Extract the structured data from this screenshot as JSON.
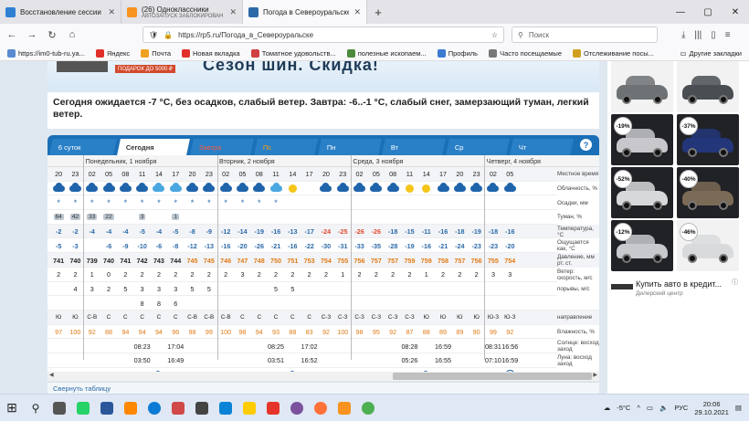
{
  "browser": {
    "tabs": [
      {
        "title": "Восстановление сессии",
        "sub": "",
        "color": "#2f7fd3",
        "active": false
      },
      {
        "title": "(26) Одноклассники",
        "sub": "АВТОЗАПУСК ЗАБЛОКИРОВАН",
        "color": "#f7931e",
        "active": false
      },
      {
        "title": "Погода в Североуральске - РП5",
        "sub": "",
        "color": "#2b6aa8",
        "active": true
      }
    ],
    "tab_close": "✕",
    "new_tab": "+",
    "window_controls": [
      "—",
      "▢",
      "✕"
    ],
    "nav": {
      "back": "←",
      "forward": "→",
      "reload": "↻",
      "home": "⌂"
    },
    "url": "https://rp5.ru/Погода_в_Североуральске",
    "search_placeholder": "Поиск",
    "bookmarks": [
      {
        "label": "https://im0-tub-ru.ya...",
        "color": "#5a8ad0"
      },
      {
        "label": "Яндекс",
        "color": "#e0302a"
      },
      {
        "label": "Почта",
        "color": "#f0a020"
      },
      {
        "label": "Новая вкладка",
        "color": "#e0302a"
      },
      {
        "label": "Томатное удовольств...",
        "color": "#d04040"
      },
      {
        "label": "полезные ископаем...",
        "color": "#4b8b3b"
      },
      {
        "label": "Профиль",
        "color": "#3b7bd0"
      },
      {
        "label": "Часто посещаемые",
        "color": "#777777"
      },
      {
        "label": "Отслеживание посы...",
        "color": "#d0a020"
      }
    ],
    "other_bookmarks": "Другие закладки"
  },
  "page": {
    "banner_text": "Сезон шин. Скидка!",
    "banner_small": "ПОДАРОК ДО 5000 ₽",
    "summary": "Сегодня ожидается -7 °С, без осадков, слабый ветер. Завтра: -6..-1 °С, слабый снег, замерзающий туман, легкий ветер.",
    "weather_tabs": [
      {
        "label": "6 суток",
        "style": "normal"
      },
      {
        "label": "Сегодня",
        "style": "active"
      },
      {
        "label": "Завтра",
        "style": "red"
      },
      {
        "label": "Пс",
        "style": "orange"
      },
      {
        "label": "Пн",
        "style": "normal"
      },
      {
        "label": "Вт",
        "style": "normal"
      },
      {
        "label": "Ср",
        "style": "normal"
      },
      {
        "label": "Чт",
        "style": "normal"
      }
    ],
    "help": "?",
    "days": [
      {
        "label": "Понедельник, 1 ноября",
        "start": 2
      },
      {
        "label": "Вторник, 2 ноября",
        "start": 10
      },
      {
        "label": "Среда, 3 ноября",
        "start": 18
      },
      {
        "label": "Четверг, 4 ноября",
        "start": 26
      }
    ],
    "hours": [
      "20",
      "23",
      "02",
      "05",
      "08",
      "11",
      "14",
      "17",
      "20",
      "23",
      "02",
      "05",
      "08",
      "11",
      "14",
      "17",
      "20",
      "23",
      "02",
      "05",
      "08",
      "11",
      "14",
      "17",
      "20",
      "23",
      "02",
      "05"
    ],
    "cloud_icons": [
      "cloud",
      "cloud",
      "cloud",
      "cloud",
      "cloud",
      "cloud",
      "cloud-light",
      "cloud-light",
      "cloud",
      "cloud",
      "cloud",
      "cloud",
      "cloud",
      "cloud-light",
      "sun",
      "",
      "cloud",
      "cloud",
      "cloud",
      "cloud",
      "cloud",
      "sun",
      "sun",
      "cloud",
      "cloud",
      "cloud",
      "cloud",
      "cloud"
    ],
    "precip": [
      "*",
      "*",
      "*",
      "*",
      "*",
      "*",
      "*",
      "*",
      "*",
      "*",
      "*",
      "*",
      "*",
      "*",
      "",
      "",
      "",
      "",
      "",
      "",
      "",
      "",
      "",
      "",
      "",
      "",
      "",
      ""
    ],
    "fog": [
      "64",
      "42",
      "33",
      "22",
      "",
      "3",
      "",
      "1",
      "",
      "",
      "",
      "",
      "",
      "",
      "",
      "",
      "",
      "",
      "",
      "",
      "",
      "",
      "",
      "",
      "",
      "",
      "",
      ""
    ],
    "temperature": [
      "-2",
      "-2",
      "-4",
      "-4",
      "-4",
      "-5",
      "-4",
      "-5",
      "-8",
      "-9",
      "-12",
      "-14",
      "-19",
      "-16",
      "-13",
      "-17",
      "-24",
      "-25",
      "-26",
      "-26",
      "-18",
      "-15",
      "-11",
      "-16",
      "-18",
      "-19",
      "-18",
      "-16",
      "-14"
    ],
    "feels_like": [
      "-5",
      "-3",
      "",
      "-6",
      "-9",
      "-10",
      "-6",
      "-8",
      "-12",
      "-13",
      "-16",
      "-20",
      "-26",
      "-21",
      "-16",
      "-22",
      "-30",
      "-31",
      "-33",
      "-35",
      "-28",
      "-19",
      "-16",
      "-21",
      "-24",
      "-23",
      "-23",
      "-20"
    ],
    "pressure": [
      "741",
      "740",
      "739",
      "740",
      "741",
      "742",
      "743",
      "744",
      "745",
      "745",
      "746",
      "747",
      "748",
      "750",
      "751",
      "753",
      "754",
      "755",
      "756",
      "757",
      "757",
      "759",
      "759",
      "758",
      "757",
      "756",
      "755",
      "754"
    ],
    "wind": [
      "2",
      "2",
      "1",
      "0",
      "2",
      "2",
      "2",
      "2",
      "2",
      "2",
      "2",
      "3",
      "2",
      "2",
      "2",
      "2",
      "2",
      "1",
      "2",
      "2",
      "2",
      "2",
      "1",
      "2",
      "2",
      "2",
      "3",
      "3"
    ],
    "gusts": [
      "",
      "4",
      "3",
      "2",
      "5",
      "3",
      "3",
      "3",
      "5",
      "5",
      "",
      "",
      "",
      "5",
      "5",
      "",
      "",
      "",
      "",
      "",
      "",
      "",
      "",
      "",
      "",
      "",
      "",
      ""
    ],
    "gusts2": [
      "",
      "",
      "",
      "",
      "",
      "8",
      "8",
      "6",
      "",
      "",
      "",
      "",
      "",
      "",
      "",
      "",
      "",
      "",
      "",
      "",
      "",
      "",
      "",
      "",
      "",
      "",
      "",
      ""
    ],
    "wind_dir": [
      "Ю",
      "Ю",
      "С-В",
      "С",
      "С",
      "С",
      "С",
      "С",
      "С-В",
      "С-В",
      "С-В",
      "С",
      "С",
      "С",
      "С",
      "С",
      "С-З",
      "С-З",
      "С-З",
      "С-З",
      "С-З",
      "С-З",
      "Ю",
      "Ю",
      "Ю",
      "Ю",
      "Ю-З",
      "Ю-З"
    ],
    "humidity": [
      "97",
      "100",
      "92",
      "88",
      "94",
      "94",
      "94",
      "96",
      "98",
      "99",
      "100",
      "98",
      "94",
      "93",
      "88",
      "83",
      "92",
      "100",
      "98",
      "95",
      "92",
      "87",
      "88",
      "89",
      "89",
      "90",
      "99",
      "92",
      "84"
    ],
    "sun": [
      {
        "col": 5,
        "text": "08:23"
      },
      {
        "col": 7,
        "text": "17:04"
      },
      {
        "col": 13,
        "text": "08:25"
      },
      {
        "col": 15,
        "text": "17:02"
      },
      {
        "col": 21,
        "text": "08:28"
      },
      {
        "col": 23,
        "text": "16:59"
      },
      {
        "col": 26,
        "text": "08:31"
      },
      {
        "col": 27,
        "text": "16:56"
      }
    ],
    "moon": [
      {
        "col": 5,
        "text": "03:50"
      },
      {
        "col": 7,
        "text": "16:49"
      },
      {
        "col": 13,
        "text": "03:51"
      },
      {
        "col": 15,
        "text": "16:52"
      },
      {
        "col": 21,
        "text": "05:26"
      },
      {
        "col": 23,
        "text": "16:55"
      },
      {
        "col": 26,
        "text": "07:10"
      },
      {
        "col": 27,
        "text": "16:59"
      }
    ],
    "moon_icons": [
      {
        "col": 6,
        "type": "crescent"
      },
      {
        "col": 14,
        "type": "crescent"
      },
      {
        "col": 22,
        "type": "crescent"
      },
      {
        "col": 27,
        "type": "full"
      }
    ],
    "row_labels": {
      "time": "Местное время",
      "clouds": "Облачность, %",
      "precip": "Осадки, мм",
      "fog": "Туман, %",
      "temp": "Температура, °С",
      "feels": "Ощущается как, °С",
      "pressure": "Давление, мм рт. ст.",
      "wind": "Ветер: скорость, м/с",
      "gusts": "порывы, м/с",
      "dir": "направление",
      "humidity": "Влажность, %",
      "sun": "Солнце: восход заход",
      "moon": "Луна: восход заход",
      "phase": "фаза"
    },
    "collapse": "Свернуть таблицу",
    "scroll_left": "◀",
    "scroll_right": "▶"
  },
  "ads": {
    "cars": [
      {
        "badge": "",
        "bg": "light",
        "color": "#6e7275"
      },
      {
        "badge": "",
        "bg": "light",
        "color": "#4a4d52"
      },
      {
        "badge": "-19%",
        "bg": "dark",
        "color": "#c8c8cc"
      },
      {
        "badge": "-37%",
        "bg": "dark",
        "color": "#23367a"
      },
      {
        "badge": "-52%",
        "bg": "dark",
        "color": "#d7d8da"
      },
      {
        "badge": "-40%",
        "bg": "dark",
        "color": "#7b6a55"
      },
      {
        "badge": "-12%",
        "bg": "dark",
        "color": "#c8c9cc"
      },
      {
        "badge": "-46%",
        "bg": "light",
        "color": "#d9dadc"
      }
    ],
    "title": "Купить авто в кредит...",
    "subtitle": "Дилерский центр",
    "info": "ⓘ"
  },
  "taskbar": {
    "start": "⊞",
    "search": "⚲",
    "apps": [
      {
        "name": "task-view",
        "color": "#555555"
      },
      {
        "name": "whatsapp",
        "color": "#25d366"
      },
      {
        "name": "word",
        "color": "#2b579a"
      },
      {
        "name": "vlc",
        "color": "#ff8800"
      },
      {
        "name": "edge",
        "color": "#0c7bd6"
      },
      {
        "name": "paint",
        "color": "#d04848"
      },
      {
        "name": "calc",
        "color": "#444444"
      },
      {
        "name": "mail",
        "color": "#0a83d6"
      },
      {
        "name": "yandex",
        "color": "#ffcc00"
      },
      {
        "name": "yandex-browser",
        "color": "#e5352b"
      },
      {
        "name": "viber",
        "color": "#7b519d"
      },
      {
        "name": "firefox",
        "color": "#ff7139"
      },
      {
        "name": "ok",
        "color": "#f7931e"
      },
      {
        "name": "chrome",
        "color": "#4caf50"
      }
    ],
    "weather": "-5°С",
    "lang": "РУС",
    "time": "20:06",
    "date": "29.10.2021"
  }
}
